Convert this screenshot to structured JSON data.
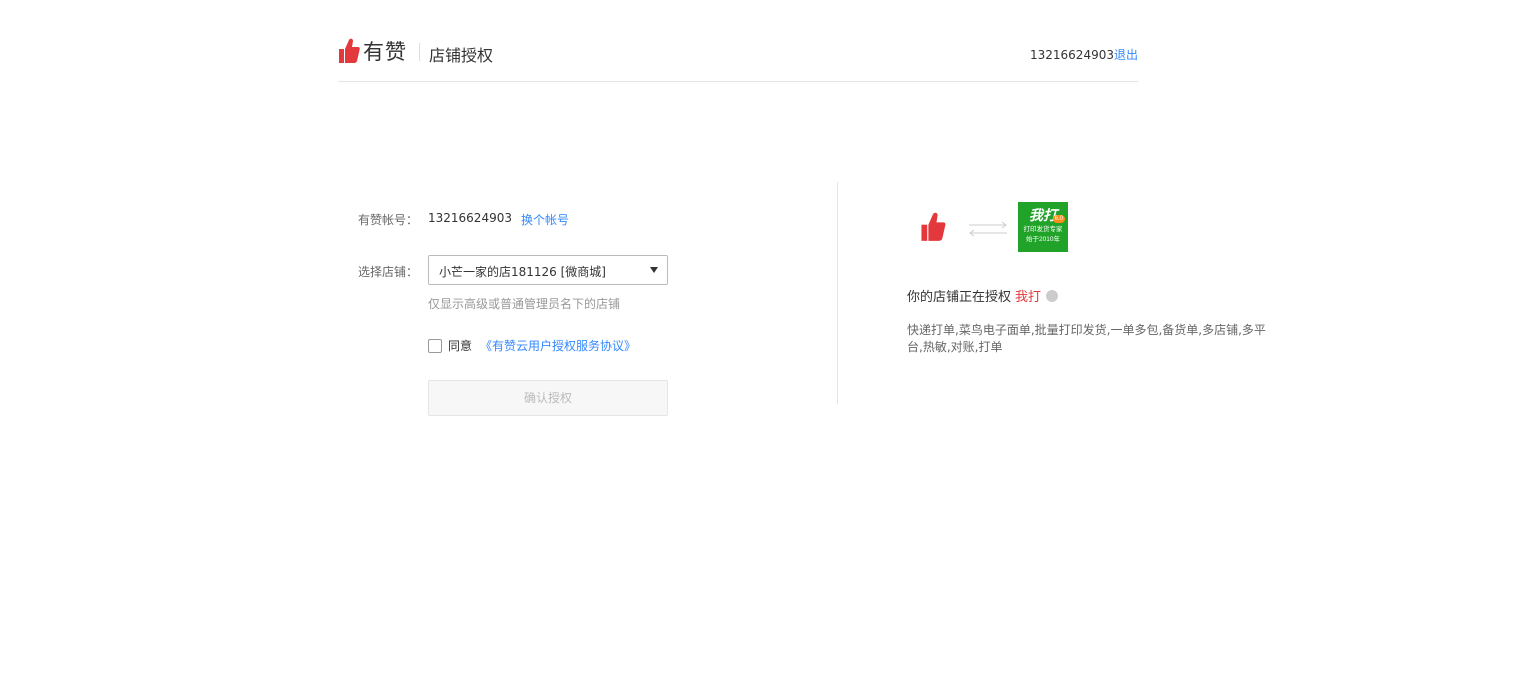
{
  "header": {
    "logo_text": "有赞",
    "title": "店铺授权",
    "account": "13216624903",
    "logout_label": "退出"
  },
  "form": {
    "account_label": "有赞帐号：",
    "account_value": "13216624903",
    "switch_account_label": "换个帐号",
    "shop_label": "选择店铺：",
    "shop_selected": "小芒一家的店181126 [微商城]",
    "shop_hint": "仅显示高级或普通管理员名下的店铺",
    "agree_label": "同意",
    "agreement_link": "《有赞云用户授权服务协议》",
    "agree_checked": false,
    "confirm_label": "确认授权"
  },
  "app": {
    "logo_main": "我打",
    "logo_version": "6.0",
    "logo_sub1": "打印发货专家",
    "logo_sub2": "始于2010年",
    "auth_prefix": "你的店铺正在授权",
    "app_name": "我打",
    "description": "快递打单,菜鸟电子面单,批量打印发货,一单多包,备货单,多店铺,多平台,热敏,对账,打单"
  },
  "colors": {
    "brand_red": "#e4393c",
    "link_blue": "#3388ff",
    "app_green": "#21a32a"
  }
}
